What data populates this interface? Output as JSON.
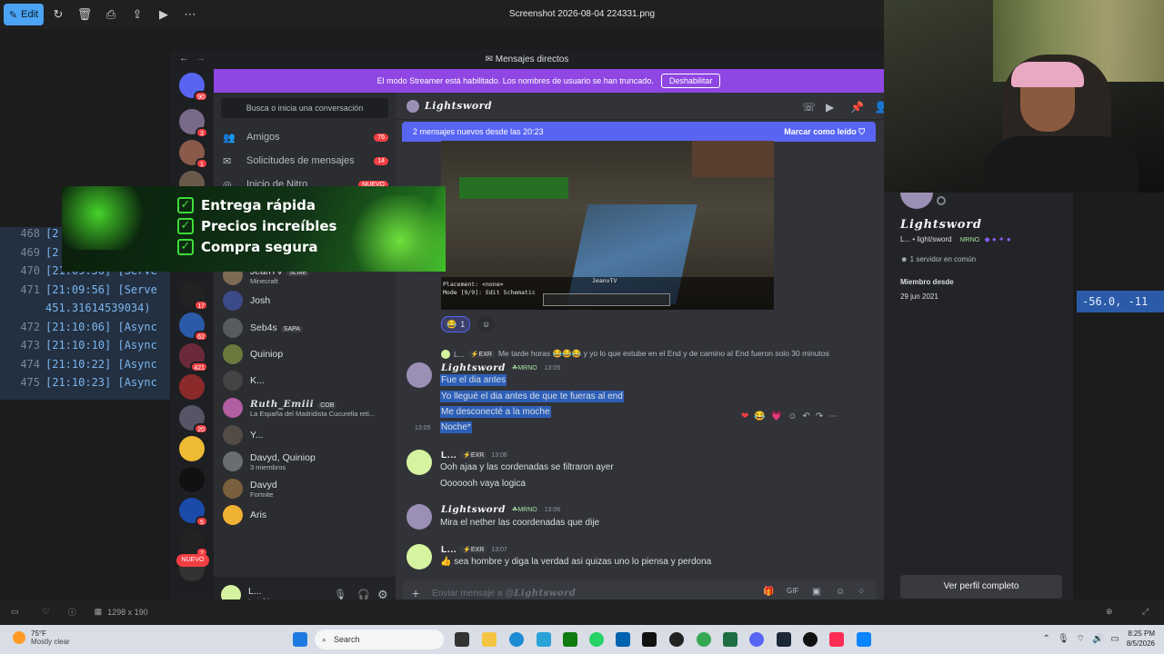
{
  "viewer": {
    "edit_label": "Edit",
    "file_title": "Screenshot 2026-08-04 224331.png",
    "dimensions": "1298 x 190",
    "icons": [
      "rotate-icon",
      "delete-icon",
      "print-icon",
      "share-icon",
      "slideshow-icon",
      "more-icon"
    ]
  },
  "terminal": {
    "lines": [
      {
        "ln": "468",
        "text": "[2"
      },
      {
        "ln": "469",
        "text": "[2"
      },
      {
        "ln": "470",
        "text": "[21:09:56] [Serve"
      },
      {
        "ln": "471",
        "text": "[21:09:56] [Serve"
      },
      {
        "ln": "",
        "text": "451.31614539034)"
      },
      {
        "ln": "472",
        "text": "[21:10:06] [Async"
      },
      {
        "ln": "473",
        "text": "[21:10:10] [Async"
      },
      {
        "ln": "474",
        "text": "[21:10:22] [Async"
      },
      {
        "ln": "475",
        "text": "[21:10:23] [Async"
      }
    ],
    "right_text": "-56.0, -11"
  },
  "discord": {
    "window_title": "Mensajes directos",
    "streamer": {
      "text": "El modo Streamer está habilitado. Los nombres de usuario se han truncado.",
      "button": "Deshabilitar"
    },
    "rail_badges": [
      "90",
      "3",
      "1",
      "1",
      "17",
      "62",
      "421",
      "20",
      "5",
      "2"
    ],
    "new_pill": "NUEVO",
    "search_placeholder": "Busca o inicia una conversación",
    "nav": [
      {
        "label": "Amigos",
        "count": "76",
        "icon": "friends-icon"
      },
      {
        "label": "Solicitudes de mensajes",
        "count": "14",
        "icon": "inbox-icon"
      },
      {
        "label": "Inicio de Nitro",
        "count": "NUEVO",
        "icon": "nitro-icon"
      }
    ],
    "dms": [
      {
        "name": "Lightsword",
        "tag": "MRNO",
        "sub": "",
        "fancy": true,
        "active": true,
        "color": "#9c8fb5"
      },
      {
        "name": "JeanTV",
        "tag": "SLME",
        "sub": "Minecraft",
        "fancy": false,
        "active": false,
        "color": "#7d6a55"
      },
      {
        "name": "Josh",
        "tag": "",
        "sub": "",
        "fancy": false,
        "active": false,
        "color": "#3d4a8a"
      },
      {
        "name": "Seb4s",
        "tag": "SAPA",
        "sub": "",
        "fancy": false,
        "active": false,
        "color": "#575a5f"
      },
      {
        "name": "Quiniop",
        "tag": "",
        "sub": "",
        "fancy": false,
        "active": false,
        "color": "#6b7a3c"
      },
      {
        "name": "K...",
        "tag": "",
        "sub": "",
        "fancy": false,
        "active": false,
        "color": "#444"
      },
      {
        "name": "Ruth_Emiii",
        "tag": "COB",
        "sub": "La España del Madridista Cucurella reti...",
        "fancy": true,
        "active": false,
        "color": "#b35ea1"
      },
      {
        "name": "Y...",
        "tag": "",
        "sub": "",
        "fancy": false,
        "active": false,
        "color": "#524c44"
      },
      {
        "name": "Davyd, Quiniop",
        "tag": "",
        "sub": "3 miembros",
        "fancy": false,
        "active": false,
        "color": "#6a6e73"
      },
      {
        "name": "Davyd",
        "tag": "",
        "sub": "Fortnite",
        "fancy": false,
        "active": false,
        "color": "#7a5f3e"
      },
      {
        "name": "Aris",
        "tag": "",
        "sub": "",
        "fancy": false,
        "active": false,
        "color": "#f0b232"
      }
    ],
    "user": {
      "name": "L...",
      "status": "Invisible"
    },
    "chat": {
      "header_name": "Lightsword",
      "new_messages": "2 mensajes nuevos desde las 20:23",
      "mark_read": "Marcar como leído",
      "mc_hud": [
        "Placement: <none>",
        "Mode [9/9]: Edit Schematic"
      ],
      "mc_caption": "JeanvTV",
      "reaction_count": "1",
      "reply_author": "L...",
      "reply_tag": "EXR",
      "reply_text": "Me tarde horas 😂😂😂 y yo lo que estube en el End y de camino al End fueron solo 30 minutos",
      "messages": [
        {
          "author": "Lightsword",
          "tag": "MRNO",
          "time": "13:05",
          "lines": [
            "Fue el dia antes",
            "Yo llegué el dia antes de que te fueras al end",
            "Me desconecté a la moche",
            "Noche*"
          ],
          "side_time": "13:05"
        },
        {
          "author": "L...",
          "tag": "EXR",
          "time": "13:06",
          "lines": [
            "Ooh ajaa y las cordenadas se filtraron ayer",
            "Ooooooh vaya logica"
          ]
        },
        {
          "author": "Lightsword",
          "tag": "MRNO",
          "time": "13:06",
          "lines": [
            "Mira el nether las coordenadas que dije"
          ]
        },
        {
          "author": "L...",
          "tag": "EXR",
          "time": "13:07",
          "lines": [
            "sea hombre y diga la verdad asi quizas uno lo piensa y perdona"
          ]
        }
      ],
      "composer_prefix": "Enviar mensaje a @",
      "composer_name": "Lightsword"
    },
    "profile": {
      "name": "Lightsword",
      "handle": "L... • light/sword",
      "tag": "MRNO",
      "mutual": "1 servidor en común",
      "member_since_label": "Miembro desde",
      "member_since": "29 jun 2021",
      "full_profile": "Ver perfil completo"
    }
  },
  "promo": {
    "lines": [
      "Entrega rápida",
      "Precios increíbles",
      "Compra segura"
    ]
  },
  "taskbar": {
    "temp": "75°F",
    "weather": "Mostly clear",
    "search": "Search",
    "time": "8:25 PM",
    "date": "8/5/2026"
  }
}
